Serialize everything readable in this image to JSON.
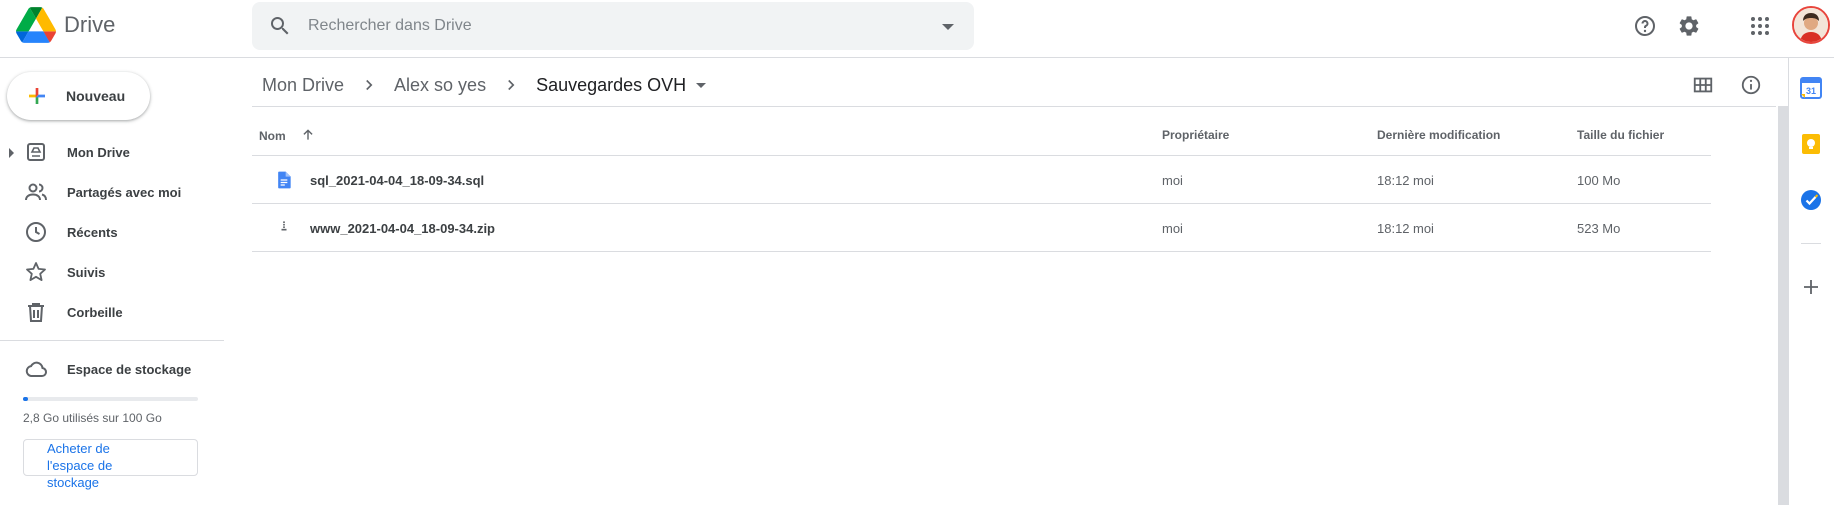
{
  "app": {
    "name": "Drive",
    "search_placeholder": "Rechercher dans Drive",
    "brand_colors": {
      "blue": "#4285f4",
      "green": "#0f9d58",
      "yellow": "#f4b400",
      "red": "#db4437"
    },
    "accent": "#1a73e8"
  },
  "header": {
    "icons": [
      "help-icon",
      "settings-icon",
      "apps-icon",
      "account-avatar"
    ]
  },
  "sidebar": {
    "new_label": "Nouveau",
    "items": [
      {
        "label": "Mon Drive",
        "icon": "my-drive-icon"
      },
      {
        "label": "Partagés avec moi",
        "icon": "shared-icon"
      },
      {
        "label": "Récents",
        "icon": "clock-icon"
      },
      {
        "label": "Suivis",
        "icon": "star-icon"
      },
      {
        "label": "Corbeille",
        "icon": "trash-icon"
      }
    ],
    "storage": {
      "label": "Espace de stockage",
      "used_text": "2,8 Go utilisés sur 100 Go",
      "used_fraction": 0.028,
      "buy_label": "Acheter de l'espace de stockage"
    }
  },
  "breadcrumb": [
    "Mon Drive",
    "Alex so yes",
    "Sauvegardes OVH"
  ],
  "table": {
    "columns": [
      "Nom",
      "Propriétaire",
      "Dernière modification",
      "Taille du fichier"
    ],
    "sort_column": "Nom",
    "sort_direction": "ascending",
    "rows": [
      {
        "name": "sql_2021-04-04_18-09-34.sql",
        "type": "document",
        "owner": "moi",
        "time": "18:12",
        "by": "moi",
        "size": "100 Mo"
      },
      {
        "name": "www_2021-04-04_18-09-34.zip",
        "type": "zip",
        "owner": "moi",
        "time": "18:12",
        "by": "moi",
        "size": "523 Mo"
      }
    ]
  },
  "side_panel": {
    "icons": [
      "calendar-icon",
      "keep-icon",
      "tasks-icon",
      "add-icon"
    ],
    "calendar_day": "31"
  }
}
